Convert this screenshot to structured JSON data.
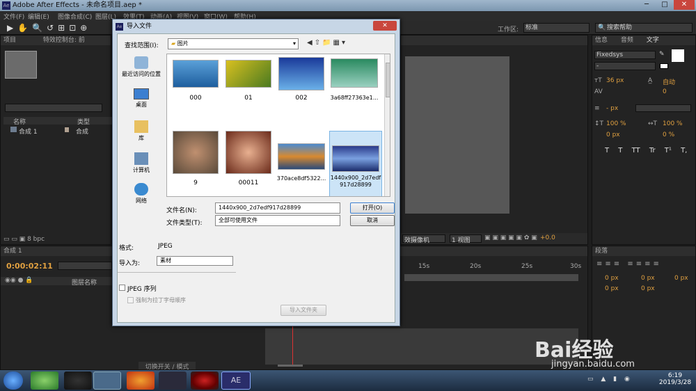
{
  "window": {
    "title": "Adobe After Effects - 未命名项目.aep *",
    "min": "─",
    "max": "□",
    "close": "✕"
  },
  "menu": [
    "文件(F)",
    "编辑(E)",
    "图像合成(C)",
    "图层(L)",
    "效果(T)",
    "动画(A)",
    "视图(V)",
    "窗口(W)",
    "帮助(H)"
  ],
  "toolbar": {
    "workspace_label": "工作区:",
    "workspace_value": "标准",
    "search_placeholder": "搜索帮助"
  },
  "project": {
    "tab": "项目",
    "effects_tab": "特效控制台: 前",
    "col_name": "名称",
    "col_type": "类型",
    "item_name": "合成 1",
    "item_type": "合成",
    "bpc": "8 bpc"
  },
  "right": {
    "tabs": [
      "信息",
      "音频",
      "文字"
    ],
    "font": "Fixedsys",
    "font_style": "-",
    "size": "36 px",
    "leading": "自动",
    "tracking": "- px",
    "scale_v": "100 %",
    "scale_h": "100 %",
    "baseline": "0 px",
    "tsume": "0 %",
    "kerning_val": "0",
    "style_btns": [
      "T",
      "T",
      "TT",
      "Tr",
      "T¹",
      "T,"
    ]
  },
  "paragraph": {
    "tab": "段落",
    "vals": [
      "0 px",
      "0 px",
      "0 px",
      "0 px",
      "0 px"
    ]
  },
  "timeline": {
    "tab": "合成 1",
    "timecode": "0:00:02:11",
    "col": "图层名称",
    "ruler": [
      "15s",
      "20s",
      "25s",
      "30s"
    ],
    "toggle": "切换开关 / 模式"
  },
  "viewer": {
    "camera": "效摄像机",
    "views": "1 视图",
    "offset": "+0.0"
  },
  "dialog": {
    "title": "导入文件",
    "lookin_label": "查找范围(I):",
    "lookin_value": "图片",
    "close": "✕",
    "places": [
      "最近访问的位置",
      "桌面",
      "库",
      "计算机",
      "网络"
    ],
    "files": [
      "000",
      "01",
      "002",
      "3a68ff27363e1...",
      "9",
      "00011",
      "370ace8df5322...",
      "1440x900_2d7edf917d28899"
    ],
    "filename_label": "文件名(N):",
    "filename_value": "1440x900_2d7edf917d28899",
    "filetype_label": "文件类型(T):",
    "filetype_value": "全部可使用文件",
    "open": "打开(O)",
    "cancel": "取消",
    "format_label": "格式:",
    "format_value": "JPEG",
    "importas_label": "导入为:",
    "importas_value": "素材",
    "sequence": "JPEG 序列",
    "alpha": "强制为拉丁字母顺序",
    "import_folder": "导入文件夹"
  },
  "taskbar": {
    "time": "6:19",
    "date": "2019/3/28",
    "ae": "AE"
  },
  "watermark": {
    "brand": "Bai经验",
    "url": "jingyan.baidu.com"
  }
}
